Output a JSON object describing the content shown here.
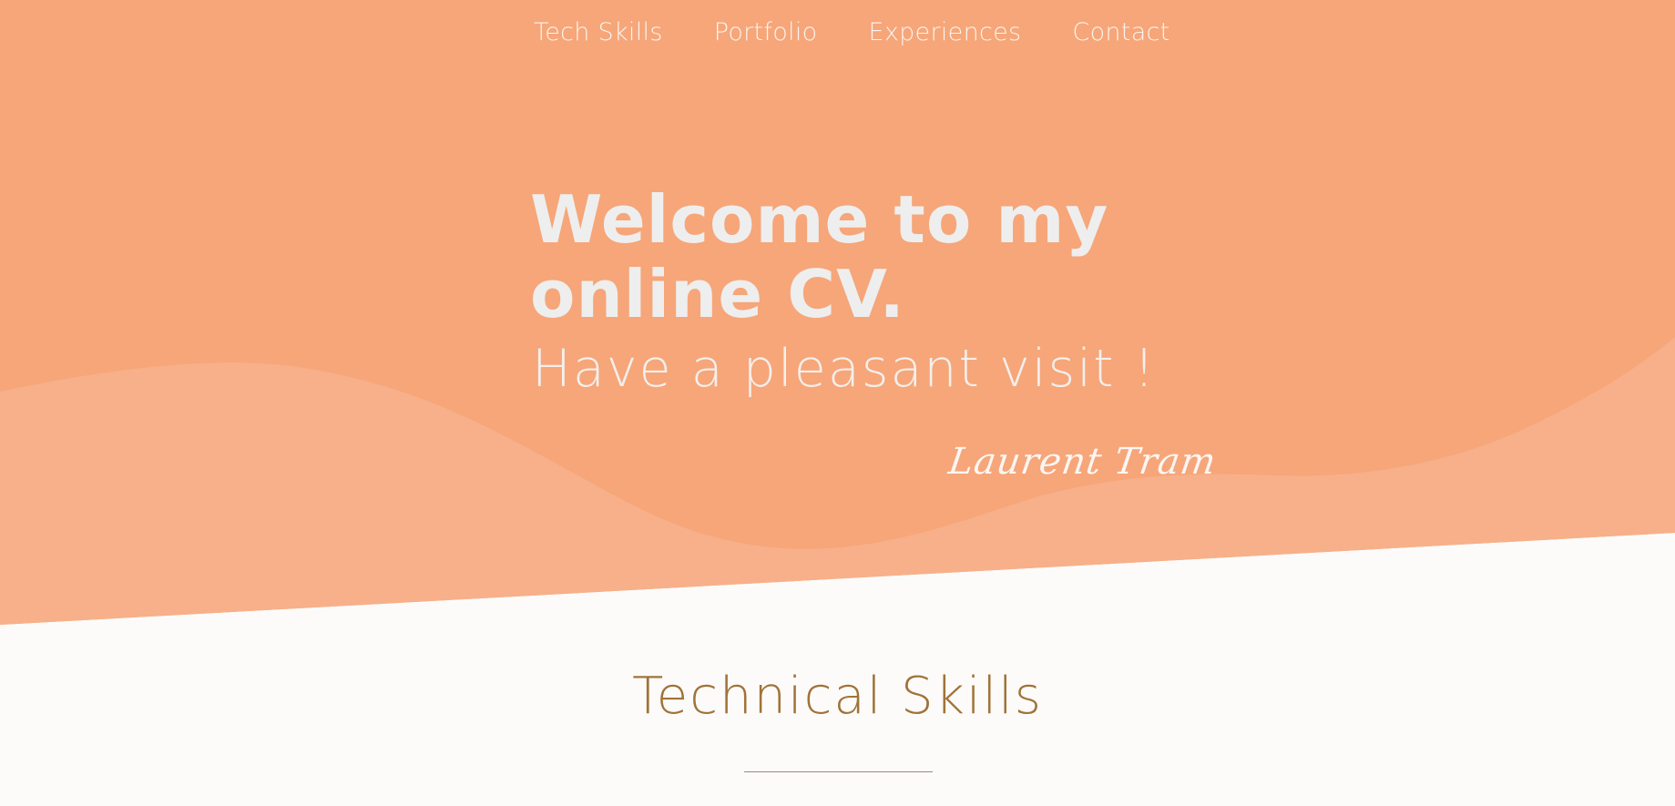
{
  "nav": {
    "items": [
      {
        "label": "Tech Skills"
      },
      {
        "label": "Portfolio"
      },
      {
        "label": "Experiences"
      },
      {
        "label": "Contact"
      }
    ]
  },
  "hero": {
    "title_line1": "Welcome to my",
    "title_line2": "online CV.",
    "subtitle": "Have a pleasant visit !",
    "signature": "Laurent Tram"
  },
  "section": {
    "title": "Technical Skills"
  },
  "colors": {
    "hero_primary": "#f6a679",
    "hero_wave": "#f7b089",
    "page_background": "#fcfbfa",
    "section_title": "#a07338",
    "hero_text": "#eeeeee"
  }
}
